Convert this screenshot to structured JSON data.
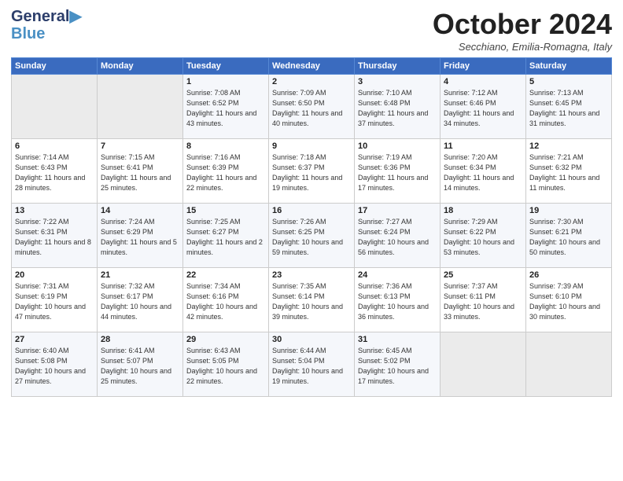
{
  "header": {
    "logo_line1": "General",
    "logo_line2": "Blue",
    "month": "October 2024",
    "location": "Secchiano, Emilia-Romagna, Italy"
  },
  "days_of_week": [
    "Sunday",
    "Monday",
    "Tuesday",
    "Wednesday",
    "Thursday",
    "Friday",
    "Saturday"
  ],
  "weeks": [
    [
      {
        "day": "",
        "sunrise": "",
        "sunset": "",
        "daylight": ""
      },
      {
        "day": "",
        "sunrise": "",
        "sunset": "",
        "daylight": ""
      },
      {
        "day": "1",
        "sunrise": "Sunrise: 7:08 AM",
        "sunset": "Sunset: 6:52 PM",
        "daylight": "Daylight: 11 hours and 43 minutes."
      },
      {
        "day": "2",
        "sunrise": "Sunrise: 7:09 AM",
        "sunset": "Sunset: 6:50 PM",
        "daylight": "Daylight: 11 hours and 40 minutes."
      },
      {
        "day": "3",
        "sunrise": "Sunrise: 7:10 AM",
        "sunset": "Sunset: 6:48 PM",
        "daylight": "Daylight: 11 hours and 37 minutes."
      },
      {
        "day": "4",
        "sunrise": "Sunrise: 7:12 AM",
        "sunset": "Sunset: 6:46 PM",
        "daylight": "Daylight: 11 hours and 34 minutes."
      },
      {
        "day": "5",
        "sunrise": "Sunrise: 7:13 AM",
        "sunset": "Sunset: 6:45 PM",
        "daylight": "Daylight: 11 hours and 31 minutes."
      }
    ],
    [
      {
        "day": "6",
        "sunrise": "Sunrise: 7:14 AM",
        "sunset": "Sunset: 6:43 PM",
        "daylight": "Daylight: 11 hours and 28 minutes."
      },
      {
        "day": "7",
        "sunrise": "Sunrise: 7:15 AM",
        "sunset": "Sunset: 6:41 PM",
        "daylight": "Daylight: 11 hours and 25 minutes."
      },
      {
        "day": "8",
        "sunrise": "Sunrise: 7:16 AM",
        "sunset": "Sunset: 6:39 PM",
        "daylight": "Daylight: 11 hours and 22 minutes."
      },
      {
        "day": "9",
        "sunrise": "Sunrise: 7:18 AM",
        "sunset": "Sunset: 6:37 PM",
        "daylight": "Daylight: 11 hours and 19 minutes."
      },
      {
        "day": "10",
        "sunrise": "Sunrise: 7:19 AM",
        "sunset": "Sunset: 6:36 PM",
        "daylight": "Daylight: 11 hours and 17 minutes."
      },
      {
        "day": "11",
        "sunrise": "Sunrise: 7:20 AM",
        "sunset": "Sunset: 6:34 PM",
        "daylight": "Daylight: 11 hours and 14 minutes."
      },
      {
        "day": "12",
        "sunrise": "Sunrise: 7:21 AM",
        "sunset": "Sunset: 6:32 PM",
        "daylight": "Daylight: 11 hours and 11 minutes."
      }
    ],
    [
      {
        "day": "13",
        "sunrise": "Sunrise: 7:22 AM",
        "sunset": "Sunset: 6:31 PM",
        "daylight": "Daylight: 11 hours and 8 minutes."
      },
      {
        "day": "14",
        "sunrise": "Sunrise: 7:24 AM",
        "sunset": "Sunset: 6:29 PM",
        "daylight": "Daylight: 11 hours and 5 minutes."
      },
      {
        "day": "15",
        "sunrise": "Sunrise: 7:25 AM",
        "sunset": "Sunset: 6:27 PM",
        "daylight": "Daylight: 11 hours and 2 minutes."
      },
      {
        "day": "16",
        "sunrise": "Sunrise: 7:26 AM",
        "sunset": "Sunset: 6:25 PM",
        "daylight": "Daylight: 10 hours and 59 minutes."
      },
      {
        "day": "17",
        "sunrise": "Sunrise: 7:27 AM",
        "sunset": "Sunset: 6:24 PM",
        "daylight": "Daylight: 10 hours and 56 minutes."
      },
      {
        "day": "18",
        "sunrise": "Sunrise: 7:29 AM",
        "sunset": "Sunset: 6:22 PM",
        "daylight": "Daylight: 10 hours and 53 minutes."
      },
      {
        "day": "19",
        "sunrise": "Sunrise: 7:30 AM",
        "sunset": "Sunset: 6:21 PM",
        "daylight": "Daylight: 10 hours and 50 minutes."
      }
    ],
    [
      {
        "day": "20",
        "sunrise": "Sunrise: 7:31 AM",
        "sunset": "Sunset: 6:19 PM",
        "daylight": "Daylight: 10 hours and 47 minutes."
      },
      {
        "day": "21",
        "sunrise": "Sunrise: 7:32 AM",
        "sunset": "Sunset: 6:17 PM",
        "daylight": "Daylight: 10 hours and 44 minutes."
      },
      {
        "day": "22",
        "sunrise": "Sunrise: 7:34 AM",
        "sunset": "Sunset: 6:16 PM",
        "daylight": "Daylight: 10 hours and 42 minutes."
      },
      {
        "day": "23",
        "sunrise": "Sunrise: 7:35 AM",
        "sunset": "Sunset: 6:14 PM",
        "daylight": "Daylight: 10 hours and 39 minutes."
      },
      {
        "day": "24",
        "sunrise": "Sunrise: 7:36 AM",
        "sunset": "Sunset: 6:13 PM",
        "daylight": "Daylight: 10 hours and 36 minutes."
      },
      {
        "day": "25",
        "sunrise": "Sunrise: 7:37 AM",
        "sunset": "Sunset: 6:11 PM",
        "daylight": "Daylight: 10 hours and 33 minutes."
      },
      {
        "day": "26",
        "sunrise": "Sunrise: 7:39 AM",
        "sunset": "Sunset: 6:10 PM",
        "daylight": "Daylight: 10 hours and 30 minutes."
      }
    ],
    [
      {
        "day": "27",
        "sunrise": "Sunrise: 6:40 AM",
        "sunset": "Sunset: 5:08 PM",
        "daylight": "Daylight: 10 hours and 27 minutes."
      },
      {
        "day": "28",
        "sunrise": "Sunrise: 6:41 AM",
        "sunset": "Sunset: 5:07 PM",
        "daylight": "Daylight: 10 hours and 25 minutes."
      },
      {
        "day": "29",
        "sunrise": "Sunrise: 6:43 AM",
        "sunset": "Sunset: 5:05 PM",
        "daylight": "Daylight: 10 hours and 22 minutes."
      },
      {
        "day": "30",
        "sunrise": "Sunrise: 6:44 AM",
        "sunset": "Sunset: 5:04 PM",
        "daylight": "Daylight: 10 hours and 19 minutes."
      },
      {
        "day": "31",
        "sunrise": "Sunrise: 6:45 AM",
        "sunset": "Sunset: 5:02 PM",
        "daylight": "Daylight: 10 hours and 17 minutes."
      },
      {
        "day": "",
        "sunrise": "",
        "sunset": "",
        "daylight": ""
      },
      {
        "day": "",
        "sunrise": "",
        "sunset": "",
        "daylight": ""
      }
    ]
  ]
}
